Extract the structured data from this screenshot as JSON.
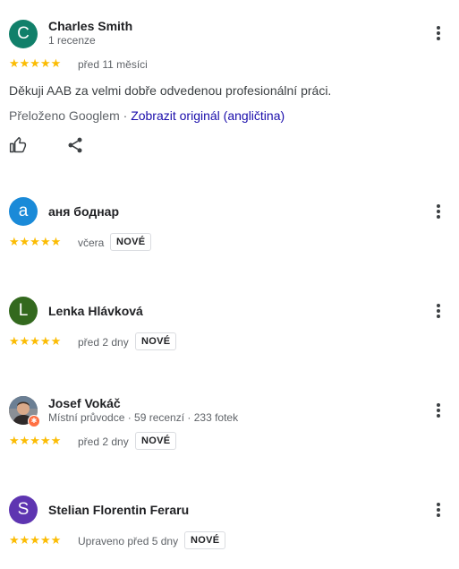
{
  "reviews": [
    {
      "avatar_letter": "C",
      "avatar_color": "#11806a",
      "name": "Charles Smith",
      "meta": "1 recenze",
      "rating": "★★★★★",
      "time": "před 11 měsíci",
      "text": "Děkuji AAB za velmi dobře odvedenou profesionální práci.",
      "translated_prefix": "Přeloženo Googlem · ",
      "show_original": "Zobrazit originál (angličtina)"
    },
    {
      "avatar_letter": "а",
      "avatar_color": "#1a8ad8",
      "name": "аня боднар",
      "rating": "★★★★★",
      "time": "včera",
      "badge": "NOVÉ"
    },
    {
      "avatar_letter": "L",
      "avatar_color": "#33691e",
      "name": "Lenka Hlávková",
      "rating": "★★★★★",
      "time": "před 2 dny",
      "badge": "NOVÉ"
    },
    {
      "name": "Josef Vokáč",
      "meta": "Místní průvodce · 59 recenzí · 233 fotek",
      "rating": "★★★★★",
      "time": "před 2 dny",
      "badge": "NOVÉ"
    },
    {
      "avatar_letter": "S",
      "avatar_color": "#5e35b1",
      "name": "Stelian Florentin Feraru",
      "rating": "★★★★★",
      "time": "Upraveno před 5 dny",
      "badge": "NOVÉ"
    }
  ],
  "colors": {
    "star": "#fbbc04",
    "link": "#1a0dab",
    "local_guide_badge": "#ff7043"
  },
  "icons": {
    "like": "thumbs-up-icon",
    "share": "share-icon",
    "more": "more-vert-icon"
  }
}
